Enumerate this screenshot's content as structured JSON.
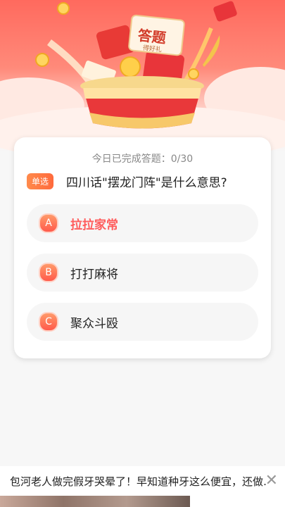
{
  "progress": {
    "label": "今日已完成答题：0/30"
  },
  "hero": {
    "sign_title": "答题",
    "sign_sub": "得好礼"
  },
  "question": {
    "badge": "单选",
    "text": "四川话\"摆龙门阵\"是什么意思?",
    "options": [
      {
        "letter": "A",
        "text": "拉拉家常",
        "selected": true
      },
      {
        "letter": "B",
        "text": "打打麻将",
        "selected": false
      },
      {
        "letter": "C",
        "text": "聚众斗殴",
        "selected": false
      }
    ]
  },
  "ad": {
    "text": "包河老人做完假牙哭晕了！早知道种牙这么便宜，还做…",
    "close_icon": "close-icon"
  },
  "colors": {
    "accent": "#ff5c5c",
    "badge": "#ff7a45",
    "hero_top": "#ff6a5e"
  }
}
